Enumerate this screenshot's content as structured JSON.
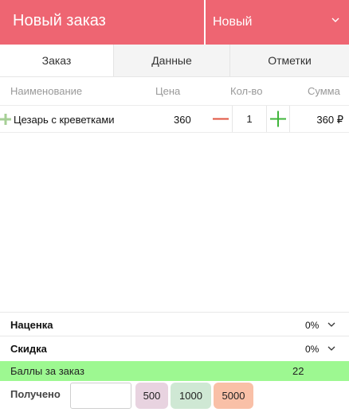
{
  "header": {
    "title": "Новый заказ",
    "status_value": "Новый"
  },
  "tabs": [
    {
      "label": "Заказ",
      "active": true
    },
    {
      "label": "Данные",
      "active": false
    },
    {
      "label": "Отметки",
      "active": false
    }
  ],
  "columns": {
    "name": "Наименование",
    "price": "Цена",
    "qty": "Кол-во",
    "sum": "Сумма"
  },
  "items": [
    {
      "name": "Цезарь с креветками",
      "price": "360",
      "qty": "1",
      "sum": "360 ₽"
    }
  ],
  "markup": {
    "label": "Наценка",
    "value": "0%"
  },
  "discount": {
    "label": "Скидка",
    "value": "0%"
  },
  "points": {
    "label": "Баллы за заказ",
    "value": "22"
  },
  "received": {
    "label": "Получено",
    "value": "",
    "quick_amounts": [
      "500",
      "1000",
      "5000"
    ]
  },
  "colors": {
    "header_bg": "#ee6572",
    "points_bg": "#9df891",
    "minus": "#e0533f",
    "plus": "#3fb53a"
  },
  "icons": [
    "chevron-down-icon",
    "minus-icon",
    "plus-icon"
  ]
}
